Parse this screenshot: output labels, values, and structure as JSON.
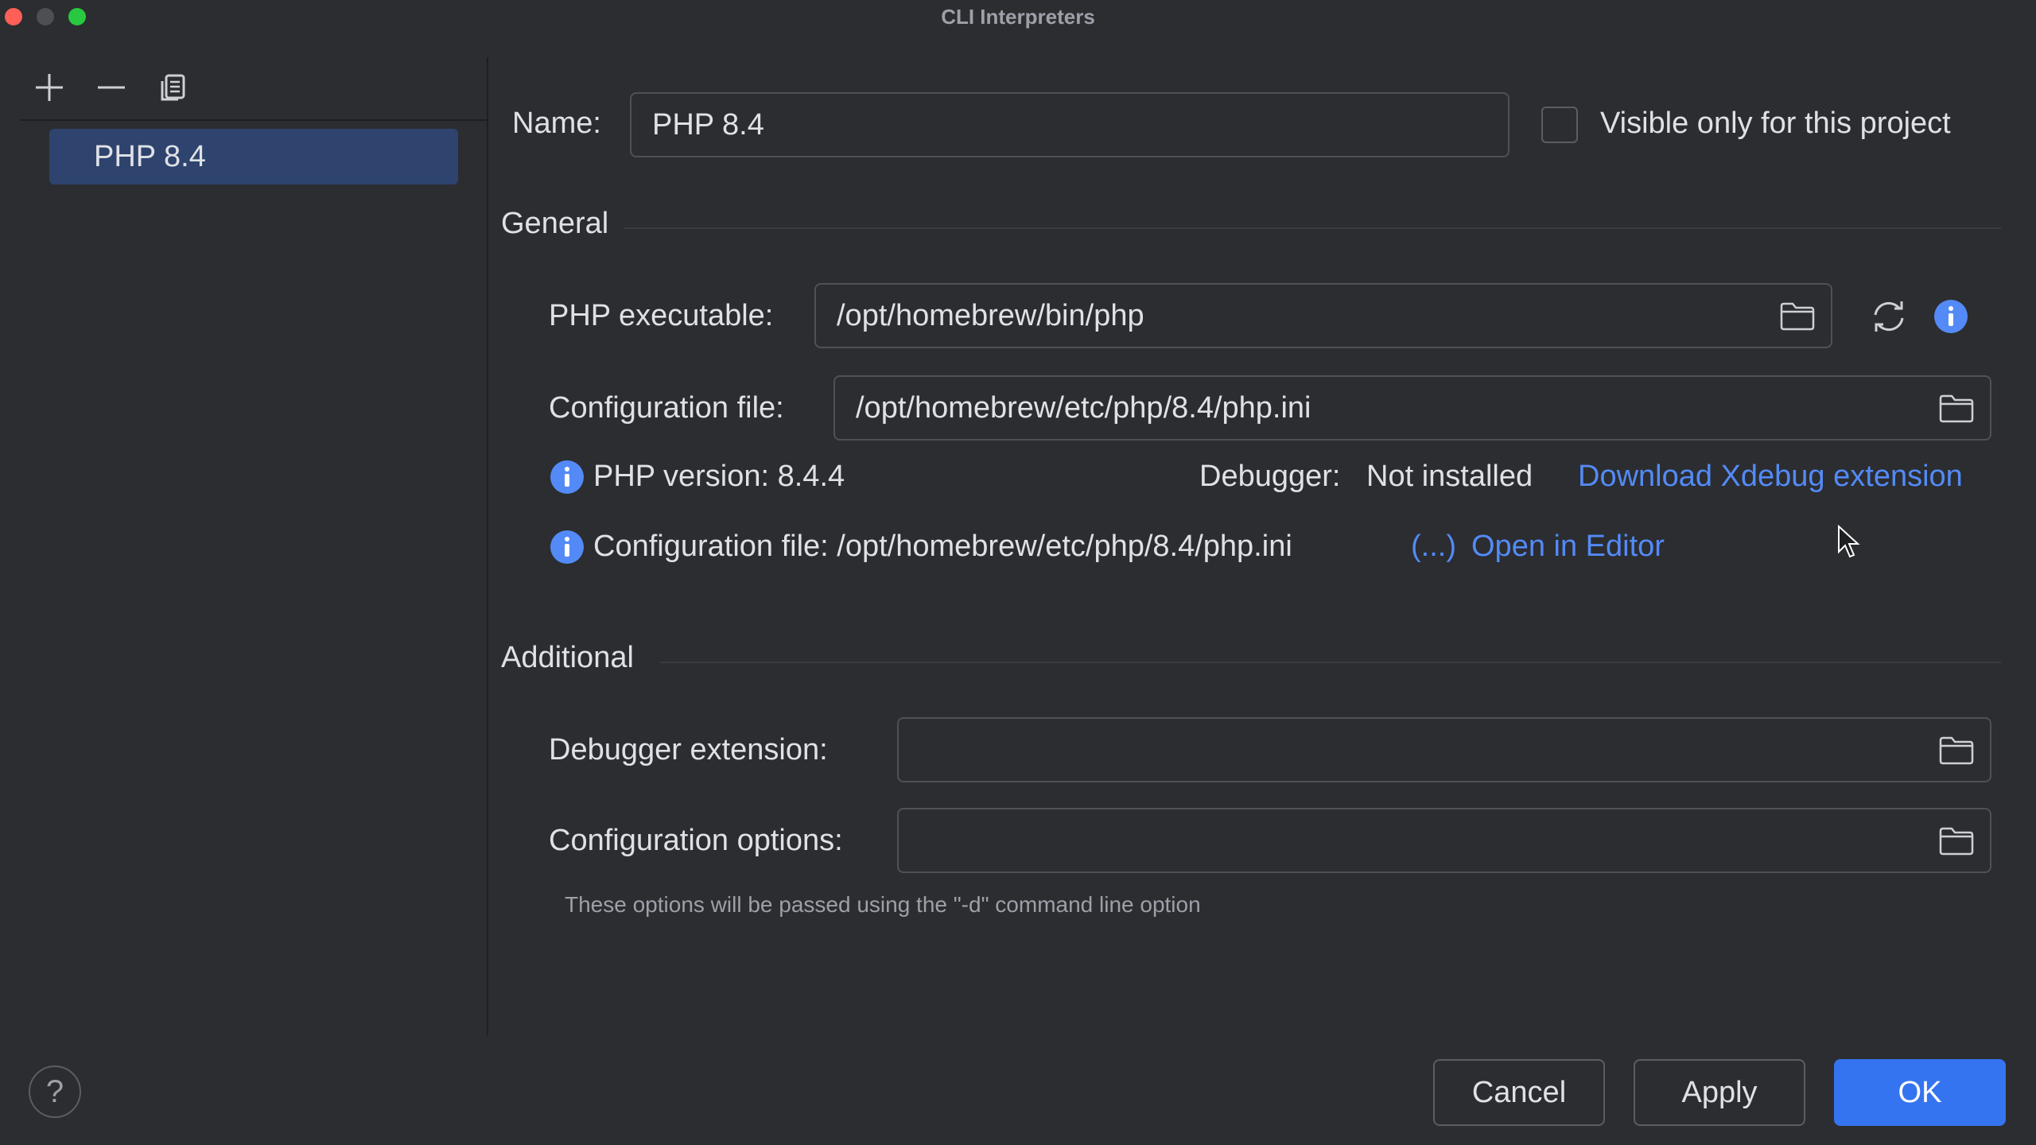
{
  "window": {
    "title": "CLI Interpreters"
  },
  "sidebar": {
    "toolbar": {
      "add_icon": "plus-icon",
      "remove_icon": "minus-icon",
      "copy_icon": "copy-icon"
    },
    "items": [
      {
        "label": "PHP 8.4",
        "selected": true
      }
    ]
  },
  "form": {
    "name_label": "Name:",
    "name_value": "PHP 8.4",
    "visible_only_label": "Visible only for this project",
    "visible_only_checked": false,
    "general": {
      "title": "General",
      "php_executable_label": "PHP executable:",
      "php_executable_value": "/opt/homebrew/bin/php",
      "config_file_label": "Configuration file:",
      "config_file_value": "/opt/homebrew/etc/php/8.4/php.ini",
      "php_version_text": "PHP version: 8.4.4",
      "debugger_label": "Debugger:",
      "debugger_value": "Not installed",
      "download_link": "Download Xdebug extension",
      "config_info_text": "Configuration file: /opt/homebrew/etc/php/8.4/php.ini",
      "more_link": "(...)",
      "open_editor_link": "Open in Editor"
    },
    "additional": {
      "title": "Additional",
      "debugger_ext_label": "Debugger extension:",
      "debugger_ext_value": "",
      "config_options_label": "Configuration options:",
      "config_options_value": "",
      "hint": "These options will be passed using the \"-d\" command line option"
    }
  },
  "buttons": {
    "help": "?",
    "cancel": "Cancel",
    "apply": "Apply",
    "ok": "OK"
  },
  "colors": {
    "background": "#2b2d30",
    "accent": "#3574f0",
    "link": "#548af7",
    "selection": "#2e436e"
  }
}
